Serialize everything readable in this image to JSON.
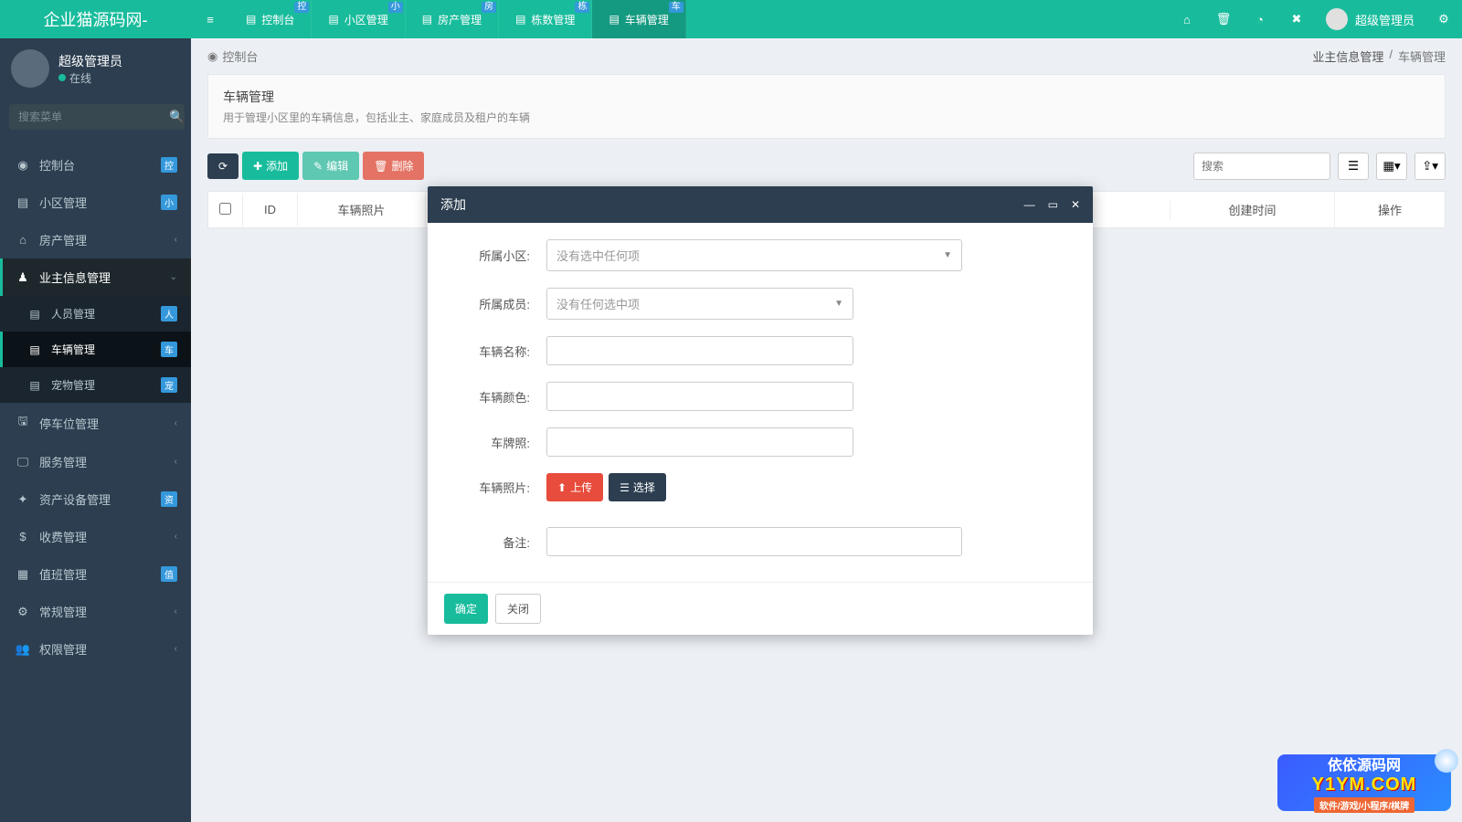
{
  "logo": "企业猫源码网-",
  "tabs": [
    {
      "label": "控制台",
      "badge": "控"
    },
    {
      "label": "小区管理",
      "badge": "小"
    },
    {
      "label": "房产管理",
      "badge": "房"
    },
    {
      "label": "栋数管理",
      "badge": "栋"
    },
    {
      "label": "车辆管理",
      "badge": "车",
      "active": true
    }
  ],
  "user": {
    "name": "超级管理员",
    "status": "在线"
  },
  "sidebar": {
    "search_placeholder": "搜索菜单",
    "items": [
      {
        "icon": "◉",
        "label": "控制台",
        "badge": "控"
      },
      {
        "icon": "▤",
        "label": "小区管理",
        "badge": "小"
      },
      {
        "icon": "⌂",
        "label": "房产管理",
        "chev": true
      },
      {
        "icon": "♟",
        "label": "业主信息管理",
        "chev_down": true,
        "active": true
      },
      {
        "icon": "▤",
        "label": "人员管理",
        "badge": "人",
        "sub": true
      },
      {
        "icon": "▤",
        "label": "车辆管理",
        "badge": "车",
        "sub": true,
        "active": true
      },
      {
        "icon": "▤",
        "label": "宠物管理",
        "badge": "宠",
        "sub": true
      },
      {
        "icon": "🖫",
        "label": "停车位管理",
        "chev": true
      },
      {
        "icon": "🖵",
        "label": "服务管理",
        "chev": true
      },
      {
        "icon": "✦",
        "label": "资产设备管理",
        "badge": "资"
      },
      {
        "icon": "$",
        "label": "收费管理",
        "chev": true
      },
      {
        "icon": "▦",
        "label": "值班管理",
        "badge": "值"
      },
      {
        "icon": "⚙",
        "label": "常规管理",
        "chev": true
      },
      {
        "icon": "👥",
        "label": "权限管理",
        "chev": true
      }
    ]
  },
  "breadcrumb": {
    "home": "控制台",
    "path1": "业主信息管理",
    "path2": "车辆管理"
  },
  "panel": {
    "title": "车辆管理",
    "desc": "用于管理小区里的车辆信息，包括业主、家庭成员及租户的车辆"
  },
  "toolbar": {
    "add": "添加",
    "edit": "编辑",
    "delete": "删除",
    "search_placeholder": "搜索"
  },
  "table": {
    "id": "ID",
    "photo": "车辆照片",
    "created": "创建时间",
    "operate": "操作"
  },
  "modal": {
    "title": "添加",
    "labels": {
      "community": "所属小区:",
      "member": "所属成员:",
      "name": "车辆名称:",
      "color": "车辆颜色:",
      "plate": "车牌照:",
      "photo": "车辆照片:",
      "remark": "备注:"
    },
    "placeholders": {
      "community": "没有选中任何项",
      "member": "没有任何选中项"
    },
    "buttons": {
      "upload": "上传",
      "choose": "选择",
      "confirm": "确定",
      "close": "关闭"
    }
  },
  "watermark": {
    "sub": "依依源码网",
    "main": "Y1YM.COM",
    "foot": "软件/游戏/小程序/棋牌"
  }
}
